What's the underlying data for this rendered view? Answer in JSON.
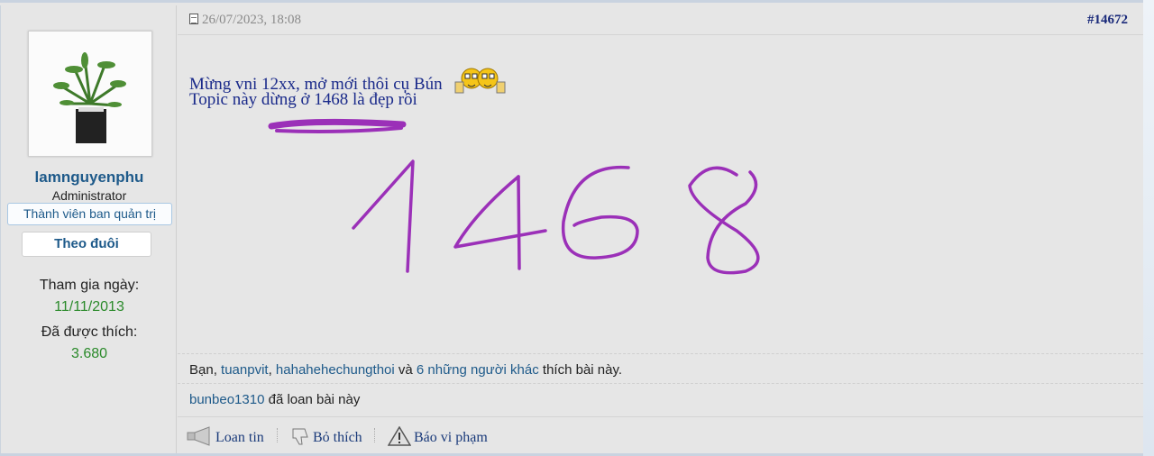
{
  "user": {
    "username": "lamnguyenphu",
    "role": "Administrator",
    "title": "Thành viên ban quản trị",
    "follow_label": "Theo đuôi",
    "joined_label": "Tham gia ngày:",
    "joined_value": "11/11/2013",
    "likes_label": "Đã được thích:",
    "likes_value": "3.680"
  },
  "post": {
    "date": "26/07/2023, 18:08",
    "number": "#14672",
    "line1": "Mừng vni 12xx, mở mới thôi cụ Bún",
    "line2": "Topic này dừng ở 1468 là đẹp rồi",
    "handwritten_number": "1468",
    "handwriting_color": "#9b30b8"
  },
  "likes": {
    "prefix": "Bạn,",
    "user1": "tuanpvit",
    "comma": ",",
    "user2": "hahahehechungthoi",
    "and": "và",
    "others": "6 những người khác",
    "suffix": "thích bài này."
  },
  "shares": {
    "user": "bunbeo1310",
    "text": "đã loan bài này"
  },
  "actions": {
    "share": "Loan tin",
    "unlike": "Bỏ thích",
    "report": "Báo vi phạm"
  }
}
